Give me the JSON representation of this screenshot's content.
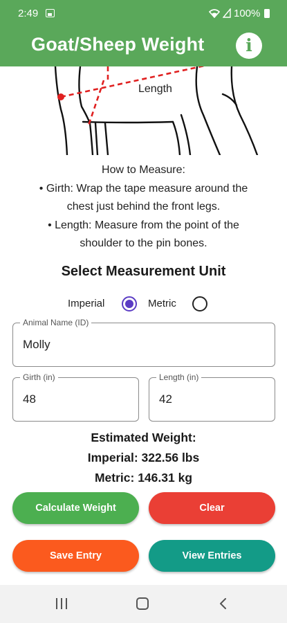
{
  "status_bar": {
    "time": "2:49",
    "battery": "100%",
    "icons": [
      "image-icon",
      "alarm-icon",
      "wifi-icon",
      "signal-icon",
      "battery-icon"
    ]
  },
  "app_bar": {
    "title": "Goat/Sheep Weight",
    "info_icon": "i"
  },
  "diagram": {
    "length_label": "Length",
    "colors": {
      "measure_line": "#e02020",
      "outline": "#111111"
    }
  },
  "instructions": {
    "heading": "How to Measure:",
    "girth_line1": "• Girth: Wrap the tape measure around the",
    "girth_line2": "chest just behind the front legs.",
    "length_line1": "• Length: Measure from the point of the",
    "length_line2": "shoulder to the pin bones."
  },
  "unit_selector": {
    "heading": "Select Measurement Unit",
    "options": [
      {
        "label": "Imperial",
        "selected": true
      },
      {
        "label": "Metric",
        "selected": false
      }
    ]
  },
  "form": {
    "animal_name": {
      "label": "Animal Name (ID)",
      "value": "Molly"
    },
    "girth": {
      "label": "Girth (in)",
      "value": "48"
    },
    "length": {
      "label": "Length (in)",
      "value": "42"
    }
  },
  "results": {
    "heading": "Estimated Weight:",
    "imperial": "Imperial: 322.56 lbs",
    "metric": "Metric: 146.31 kg"
  },
  "buttons": {
    "calculate": "Calculate Weight",
    "clear": "Clear",
    "save": "Save Entry",
    "view": "View Entries"
  },
  "colors": {
    "primary": "#5aa85a",
    "calculate": "#4caf50",
    "clear": "#ea3f35",
    "save": "#fb5a1e",
    "view": "#139b87",
    "radio_selected": "#5b3cc4"
  },
  "nav_bar": {
    "icons": [
      "recents-icon",
      "home-icon",
      "back-icon"
    ]
  }
}
